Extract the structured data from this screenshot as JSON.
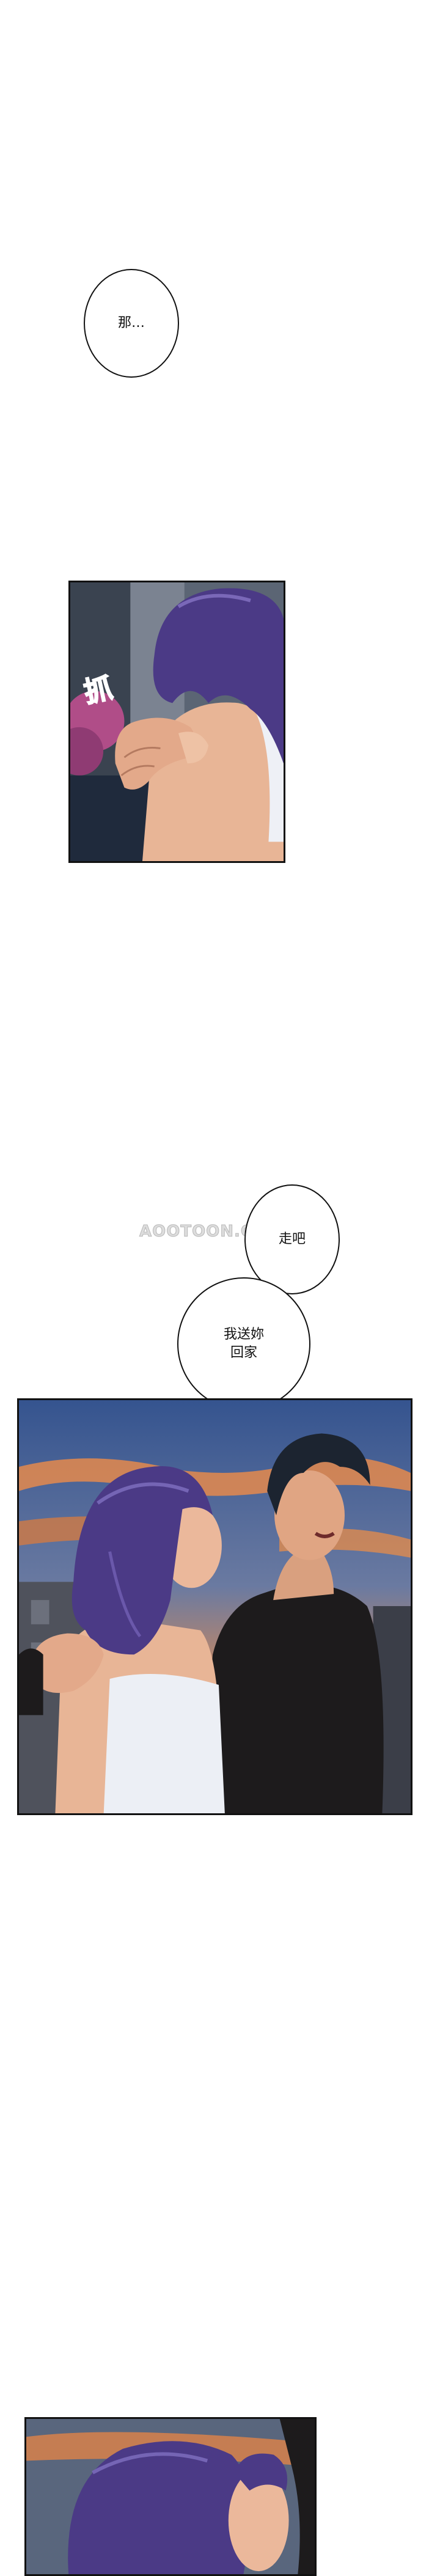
{
  "bubbles": {
    "b1": "那…",
    "b2": "走吧",
    "b3": "我送妳\n回家"
  },
  "panels": {
    "p1_sfx": "抓"
  },
  "watermark": "AOOTOON.CC",
  "colors": {
    "hair": "#4b3a86",
    "skin": "#e9b79a",
    "sky_dusk": "#e58a4c",
    "sky_blue": "#3d5b94",
    "jacket": "#1d1b1c"
  }
}
